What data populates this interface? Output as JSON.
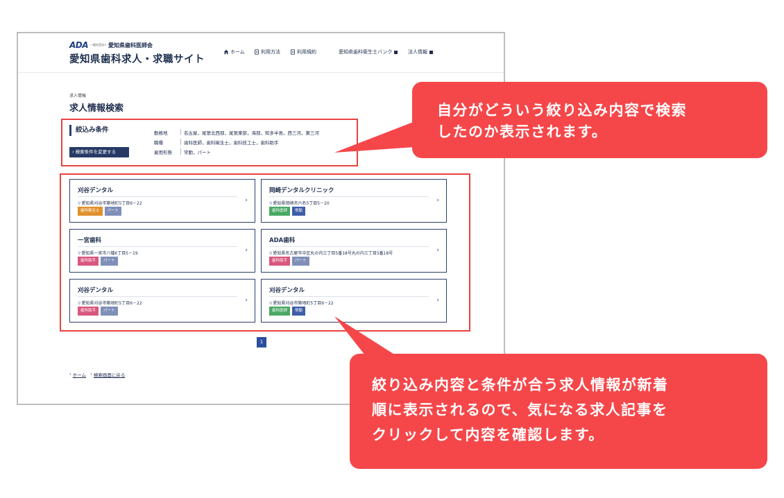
{
  "header": {
    "logo_mark": "ADA",
    "corp_small": "一般社団法人",
    "association_name": "愛知県歯科医師会",
    "site_title": "愛知県歯科求人・求職サイト",
    "nav": [
      {
        "label": "ホーム",
        "icon": "home-icon"
      },
      {
        "label": "利用方法",
        "icon": "document-icon"
      },
      {
        "label": "利用規約",
        "icon": "document-icon"
      },
      {
        "label": "愛知県歯科衛生士バンク",
        "icon": "external-link-icon"
      },
      {
        "label": "法人情報",
        "icon": "external-link-icon"
      }
    ]
  },
  "breadcrumb_small": "求人情報",
  "page_title": "求人情報検索",
  "filter": {
    "heading": "絞込み条件",
    "change_button": "検索条件を変更する",
    "conditions": [
      {
        "label": "勤務地",
        "value": "名古屋，尾張北西部，尾張東部，海部，知多半島，西三河，東三河"
      },
      {
        "label": "職種",
        "value": "歯科医師，歯科衛生士，歯科技工士，歯科助手"
      },
      {
        "label": "雇用形態",
        "value": "常勤，パート"
      }
    ]
  },
  "results": [
    {
      "name": "刈谷デンタル",
      "address": "愛知県刈谷市築地町5丁目6－22",
      "tags": [
        {
          "label": "歯科衛生士",
          "color": "#e0912b"
        },
        {
          "label": "パート",
          "color": "#7f8fb8"
        }
      ]
    },
    {
      "name": "岡崎デンタルクリニック",
      "address": "愛知県岡崎市六名5丁目5－20",
      "tags": [
        {
          "label": "歯科医師",
          "color": "#4aa964"
        },
        {
          "label": "常勤",
          "color": "#3f5da8"
        }
      ]
    },
    {
      "name": "一宮歯科",
      "address": "愛知県一宮市八幡6丁目5－19",
      "tags": [
        {
          "label": "歯科助手",
          "color": "#d9577f"
        },
        {
          "label": "パート",
          "color": "#7f8fb8"
        }
      ]
    },
    {
      "name": "ADA歯科",
      "address": "愛知県名古屋市中区丸の内三丁目5番18号丸の内三丁目5番18号",
      "tags": [
        {
          "label": "歯科助手",
          "color": "#d9577f"
        },
        {
          "label": "パート",
          "color": "#7f8fb8"
        }
      ]
    },
    {
      "name": "刈谷デンタル",
      "address": "愛知県刈谷市築地町5丁目6－22",
      "tags": [
        {
          "label": "歯科助手",
          "color": "#d9577f"
        },
        {
          "label": "パート",
          "color": "#7f8fb8"
        }
      ]
    },
    {
      "name": "刈谷デンタル",
      "address": "愛知県刈谷市築地町5丁目6－22",
      "tags": [
        {
          "label": "歯科医師",
          "color": "#4aa964"
        },
        {
          "label": "常勤",
          "color": "#3f5da8"
        }
      ]
    }
  ],
  "pager": {
    "current": "1"
  },
  "footer_links": [
    "ホーム",
    "検索画面に戻る"
  ],
  "callouts": {
    "top_line1": "自分がどういう絞り込み内容で検索",
    "top_line2": "したのか表示されます。",
    "bottom_line1": "絞り込み内容と条件が合う求人情報が新着",
    "bottom_line2": "順に表示されるので、気になる求人記事を",
    "bottom_line3": "クリックして内容を確認します。"
  },
  "colors": {
    "accent_red": "#f5474a",
    "navy": "#263a66"
  }
}
